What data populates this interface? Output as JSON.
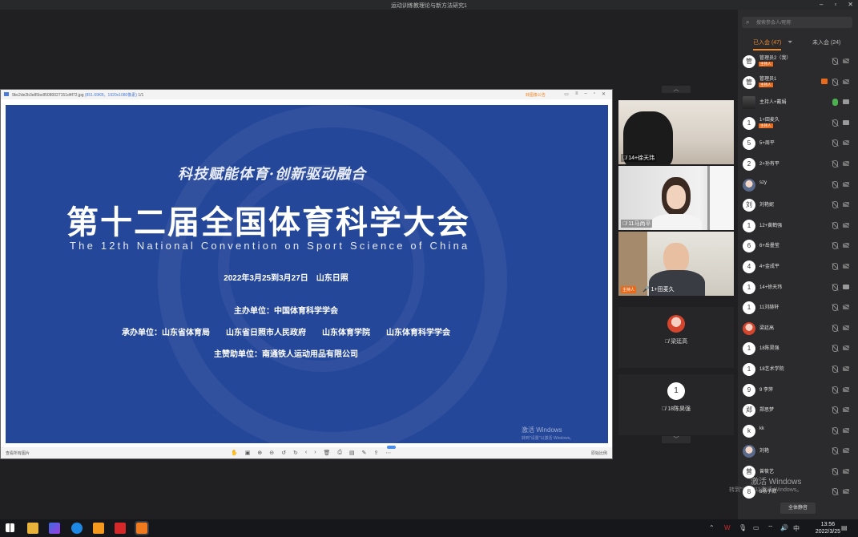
{
  "app": {
    "title": "运动训练教理论与新方法研究1"
  },
  "viewer": {
    "filename": "9bc2de2b3e85bc85080027151d4f72.jpg",
    "resolution": "(851.69KB，1920x1080像素)",
    "page": "1/1",
    "share_label": "转图像公告",
    "bottom_left": "查看所有图片",
    "bottom_right": "原始比例"
  },
  "slide": {
    "slogan": "科技赋能体育·创新驱动融合",
    "title": "第十二届全国体育科学大会",
    "english": "The 12th National Convention on Sport Science of China",
    "date_place": "2022年3月25到3月27日　山东日照",
    "host": "主办单位：中国体育科学学会",
    "organizers": "承办单位：山东省体育局　　山东省日照市人民政府　　山东体育学院　　山东体育科学学会",
    "sponsor": "主赞助单位：南通铁人运动用品有限公司",
    "watermark": "激活 Windows",
    "watermark_sub": "转到\"设置\"以激活 Windows。"
  },
  "video": {
    "tiles": [
      {
        "name": "14+徐天玮"
      },
      {
        "name": "11马尚平"
      },
      {
        "name": "1+田麦久",
        "badge": "主持人"
      }
    ],
    "placeholders": [
      {
        "name": "梁廷高",
        "avatar": ""
      },
      {
        "name": "18陈昊强",
        "avatar": "1"
      }
    ]
  },
  "panel": {
    "search_placeholder": "搜索参会人/昵称",
    "tab_in": "已入会 (47)",
    "tab_out": "未入会 (24)",
    "members": [
      {
        "avatar": "管",
        "name": "管理员2（我）",
        "tag": "主持人",
        "mic": "off",
        "cam": "off"
      },
      {
        "avatar": "管",
        "name": "管理员1",
        "tag": "主持人",
        "mic": "off",
        "cam": "off",
        "share": true
      },
      {
        "avatar": "",
        "name": "主持人+戴娟",
        "tag": "",
        "mic": "on",
        "cam": "on",
        "img": "sq"
      },
      {
        "avatar": "1",
        "name": "1+田麦久",
        "tag": "主持人",
        "mic": "on2",
        "cam": "on"
      },
      {
        "avatar": "5",
        "name": "5+周平",
        "tag": "",
        "mic": "off",
        "cam": "off"
      },
      {
        "avatar": "2",
        "name": "2+孙有平",
        "tag": "",
        "mic": "off",
        "cam": "off"
      },
      {
        "avatar": "",
        "name": "szy",
        "tag": "",
        "mic": "off",
        "cam": "off",
        "img": "img"
      },
      {
        "avatar": "刘",
        "name": "刘艳妮",
        "tag": "",
        "mic": "off",
        "cam": "off"
      },
      {
        "avatar": "1",
        "name": "12+黄鹤强",
        "tag": "",
        "mic": "off",
        "cam": "off"
      },
      {
        "avatar": "6",
        "name": "6+岳墨莹",
        "tag": "",
        "mic": "off",
        "cam": "off"
      },
      {
        "avatar": "4",
        "name": "4+金成平",
        "tag": "",
        "mic": "off",
        "cam": "off"
      },
      {
        "avatar": "1",
        "name": "14+徐天玮",
        "tag": "",
        "mic": "off",
        "cam": "on"
      },
      {
        "avatar": "1",
        "name": "11刘赫轩",
        "tag": "",
        "mic": "off",
        "cam": "off"
      },
      {
        "avatar": "",
        "name": "梁廷高",
        "tag": "",
        "mic": "off",
        "cam": "off",
        "img": "img2"
      },
      {
        "avatar": "1",
        "name": "18陈昊强",
        "tag": "",
        "mic": "off",
        "cam": "off"
      },
      {
        "avatar": "1",
        "name": "18艺术学院",
        "tag": "",
        "mic": "off",
        "cam": "off"
      },
      {
        "avatar": "9",
        "name": "9 李萍",
        "tag": "",
        "mic": "off",
        "cam": "off"
      },
      {
        "avatar": "郑",
        "name": "郑思梦",
        "tag": "",
        "mic": "off",
        "cam": "off"
      },
      {
        "avatar": "k",
        "name": "kk",
        "tag": "",
        "mic": "off",
        "cam": "off"
      },
      {
        "avatar": "",
        "name": "刘艳",
        "tag": "",
        "mic": "off",
        "cam": "off",
        "img": "img"
      },
      {
        "avatar": "曾",
        "name": "曾筱艺",
        "tag": "",
        "mic": "off",
        "cam": "off"
      },
      {
        "avatar": "8",
        "name": "8杨子默",
        "tag": "",
        "mic": "off",
        "cam": "off"
      }
    ],
    "mute_all": "全体静音",
    "watermark": "激活 Windows",
    "watermark_sub": "转到\"设置\"以激活 Windows。"
  },
  "taskbar": {
    "time": "13:56",
    "date": "2022/3/25",
    "ime": "中"
  }
}
